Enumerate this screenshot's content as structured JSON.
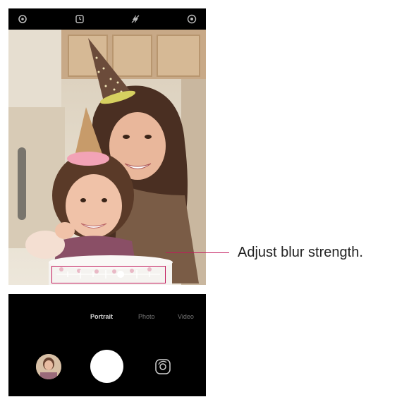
{
  "annotation": {
    "callout_text": "Adjust blur strength.",
    "accent_color": "#c2185b"
  },
  "top_bar": {
    "icons": [
      "settings-icon",
      "timer-icon",
      "flash-off-icon",
      "portrait-mode-icon"
    ]
  },
  "camera_modes": {
    "items": [
      "Portrait",
      "Photo",
      "Video"
    ],
    "selected": "Portrait"
  },
  "controls": {
    "gallery_icon": "gallery-thumbnail",
    "shutter_icon": "shutter-button",
    "switch_icon": "switch-camera-icon"
  },
  "blur_slider": {
    "level": 0.62
  }
}
